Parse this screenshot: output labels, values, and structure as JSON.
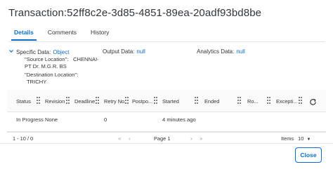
{
  "dialog": {
    "title": "Transaction:52ff8c2e-3d85-4851-89ea-20adf93bd8be"
  },
  "tabs": [
    {
      "label": "Details",
      "active": true
    },
    {
      "label": "Comments",
      "active": false
    },
    {
      "label": "History",
      "active": false
    }
  ],
  "objects": {
    "specific": {
      "label": "Specific Data:",
      "value": "Object"
    },
    "output": {
      "label": "Output Data:",
      "value": "null"
    },
    "analytics": {
      "label": "Analytics Data:",
      "value": "null"
    }
  },
  "specific_details": {
    "source_key": "\"Source Location\":",
    "source_value_1": "CHENNAI-",
    "source_value_2": "PT Dr. M.G.R. BS",
    "dest_key": "\"Destination Location\":",
    "dest_value": "TRICHY"
  },
  "table": {
    "columns": [
      "Status",
      "Revision",
      "Deadline",
      "Retry No.",
      "Postpo...",
      "Started",
      "Ended",
      "Ro...",
      "Excepti..."
    ],
    "rows": [
      {
        "status": "In Progress",
        "revision": "None",
        "deadline": "",
        "retry": "0",
        "postponed": "",
        "started": "4 minutes ago",
        "ended": "",
        "role": "",
        "exception": ""
      }
    ]
  },
  "pagination": {
    "range": "1 - 10 / 0",
    "page_label": "Page 1",
    "items_label": "Items",
    "items_value": "10"
  },
  "footer": {
    "close_label": "Close"
  },
  "colors": {
    "accent": "#0a6ed1",
    "text": "#32363a",
    "border": "#e5e5e5"
  }
}
